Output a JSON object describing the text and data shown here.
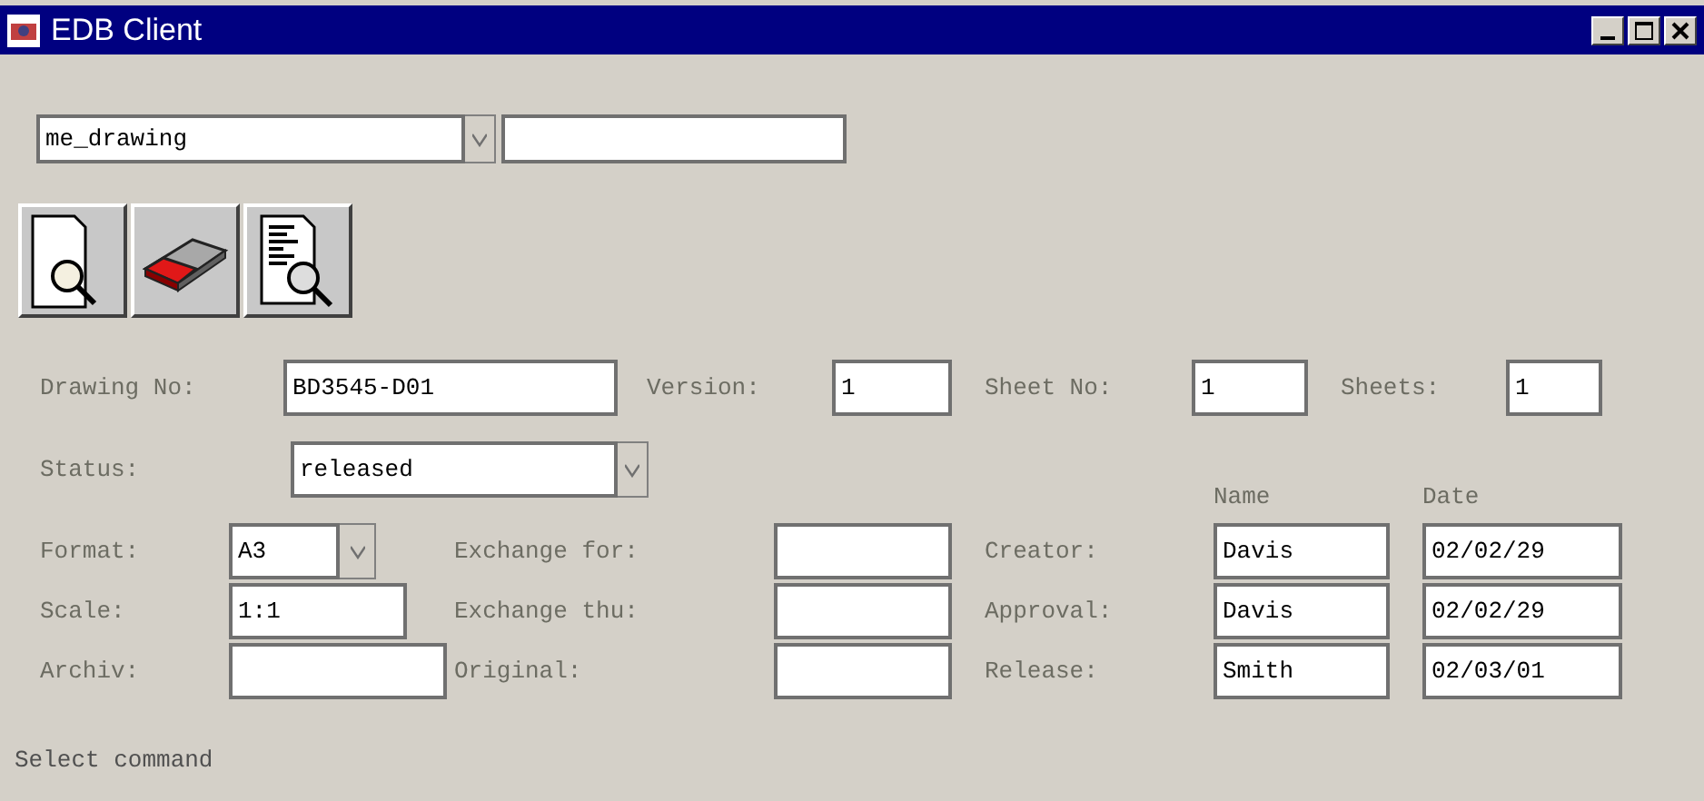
{
  "window": {
    "title": "EDB Client"
  },
  "selector": {
    "value": "me_drawing"
  },
  "toolbar": [
    {
      "kind": "page-search"
    },
    {
      "kind": "eraser"
    },
    {
      "kind": "list-search"
    }
  ],
  "drawing_no": {
    "label": "Drawing No:",
    "value": "BD3545-D01"
  },
  "version": {
    "label": "Version:",
    "value": "1"
  },
  "sheet_no": {
    "label": "Sheet No:",
    "value": "1"
  },
  "sheets": {
    "label": "Sheets:",
    "value": "1"
  },
  "status": {
    "label": "Status:",
    "value": "released"
  },
  "format": {
    "label": "Format:",
    "value": "A3"
  },
  "scale": {
    "label": "Scale:",
    "value": "1:1"
  },
  "archiv": {
    "label": "Archiv:"
  },
  "exchange_for": {
    "label": "Exchange for:"
  },
  "exchange_thu": {
    "label": "Exchange thu:"
  },
  "original": {
    "label": "Original:"
  },
  "approvals": {
    "columns": [
      "Name",
      "Date"
    ],
    "rows": [
      {
        "label": "Creator:",
        "name": "Davis",
        "date": "02/02/29"
      },
      {
        "label": "Approval:",
        "name": "Davis",
        "date": "02/02/29"
      },
      {
        "label": "Release:",
        "name": "Smith",
        "date": "02/03/01"
      }
    ]
  },
  "status_bar": "Select command"
}
